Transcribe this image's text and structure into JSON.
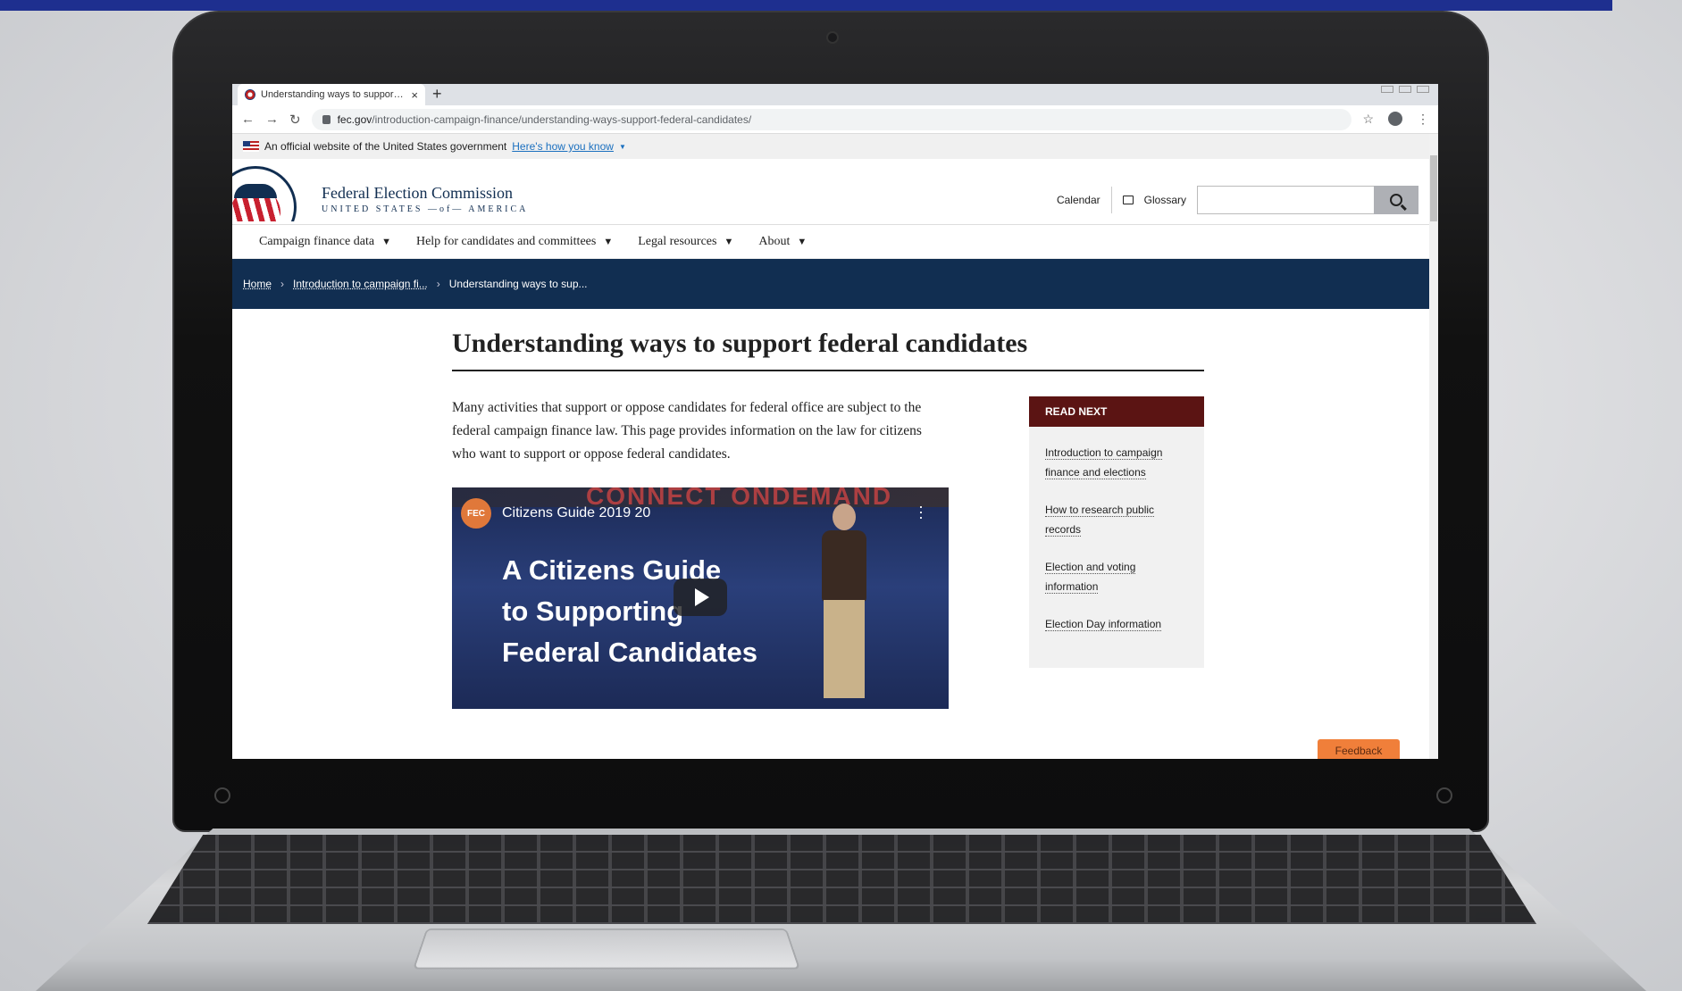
{
  "browser": {
    "tab_title": "Understanding ways to support federal candidates",
    "close_glyph": "×",
    "new_tab_glyph": "+",
    "url_host": "fec.gov",
    "url_path": "/introduction-campaign-finance/understanding-ways-support-federal-candidates/",
    "back_glyph": "←",
    "forward_glyph": "→",
    "reload_glyph": "↻",
    "star_glyph": "☆",
    "menu_glyph": "⋮"
  },
  "gov_banner": {
    "text": "An official website of the United States government",
    "link": "Here's how you know"
  },
  "header": {
    "agency_name": "Federal Election Commission",
    "agency_sub": "UNITED STATES —of— AMERICA",
    "calendar": "Calendar",
    "glossary": "Glossary",
    "search_placeholder": ""
  },
  "main_nav": [
    {
      "label": "Campaign finance data"
    },
    {
      "label": "Help for candidates and committees"
    },
    {
      "label": "Legal resources"
    },
    {
      "label": "About"
    }
  ],
  "nav_caret": "▼",
  "breadcrumbs": {
    "home": "Home",
    "parent": "Introduction to campaign fi...",
    "current": "Understanding ways to sup...",
    "sep": "›"
  },
  "page": {
    "title": "Understanding ways to support federal candidates",
    "lede": "Many activities that support or oppose candidates for federal office are subject to the federal campaign finance law. This page provides information on the law for citizens who want to support or oppose federal candidates."
  },
  "video": {
    "title": "Citizens Guide 2019 20",
    "channel_badge": "FEC",
    "watermark": "CONNECT ONDEMAND",
    "headline_1": "A Citizens Guide",
    "headline_2": "to Supporting",
    "headline_3": "Federal Candidates"
  },
  "read_next": {
    "heading": "READ NEXT",
    "links": [
      "Introduction to campaign finance and elections",
      "How to research public records",
      "Election and voting information",
      "Election Day information"
    ]
  },
  "feedback": "Feedback",
  "colors": {
    "navy": "#112e51",
    "read_next_header": "#5b1413",
    "feedback": "#f07f3a"
  }
}
